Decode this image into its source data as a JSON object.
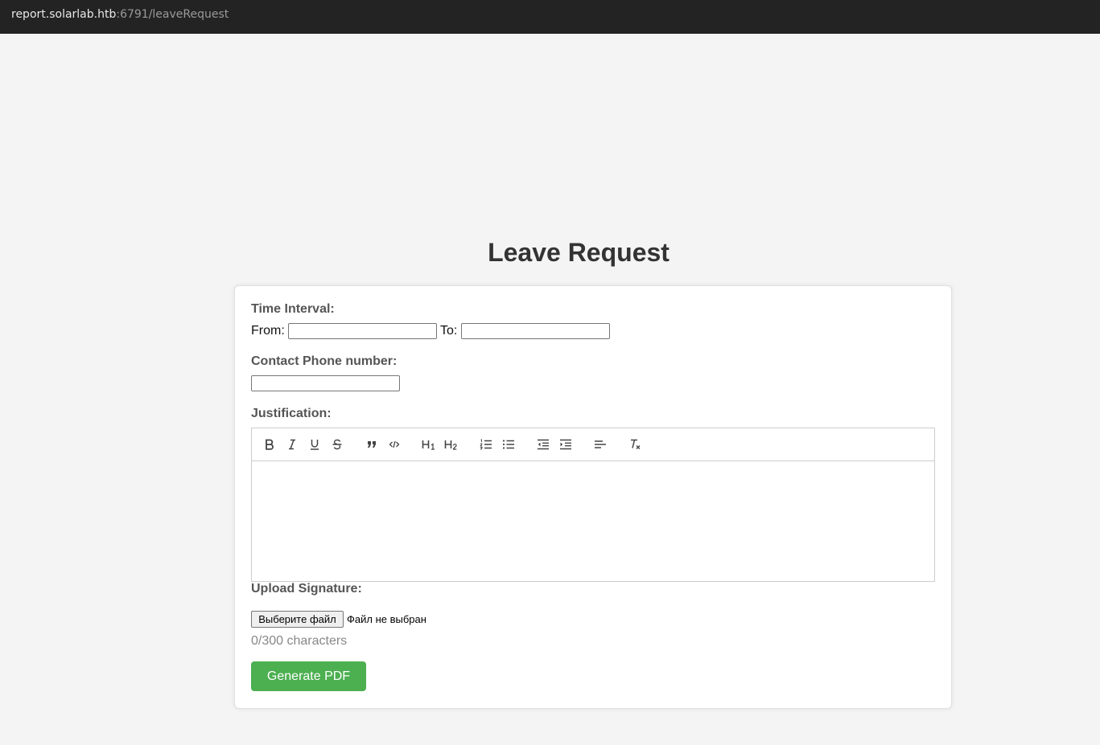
{
  "browser": {
    "url_host": "report.solarlab.htb",
    "url_path": ":6791/leaveRequest"
  },
  "page": {
    "title": "Leave Request"
  },
  "form": {
    "time_interval_label": "Time Interval:",
    "from_label": "From:",
    "from_value": "",
    "to_label": "To:",
    "to_value": "",
    "phone_label": "Contact Phone number:",
    "phone_value": "",
    "justification_label": "Justification:",
    "toolbar": [
      "bold-icon",
      "italic-icon",
      "underline-icon",
      "strike-icon",
      "blockquote-icon",
      "code-block-icon",
      "header-1-icon",
      "header-2-icon",
      "ordered-list-icon",
      "bullet-list-icon",
      "outdent-icon",
      "indent-icon",
      "align-icon",
      "clear-format-icon"
    ],
    "upload_label": "Upload Signature:",
    "file_button_label": "Выберите файл",
    "file_status": "Файл не выбран",
    "char_counter": "0/300 characters",
    "submit_label": "Generate PDF"
  },
  "colors": {
    "accent": "#4caf50",
    "background": "#f4f4f4",
    "urlbar": "#232323"
  }
}
